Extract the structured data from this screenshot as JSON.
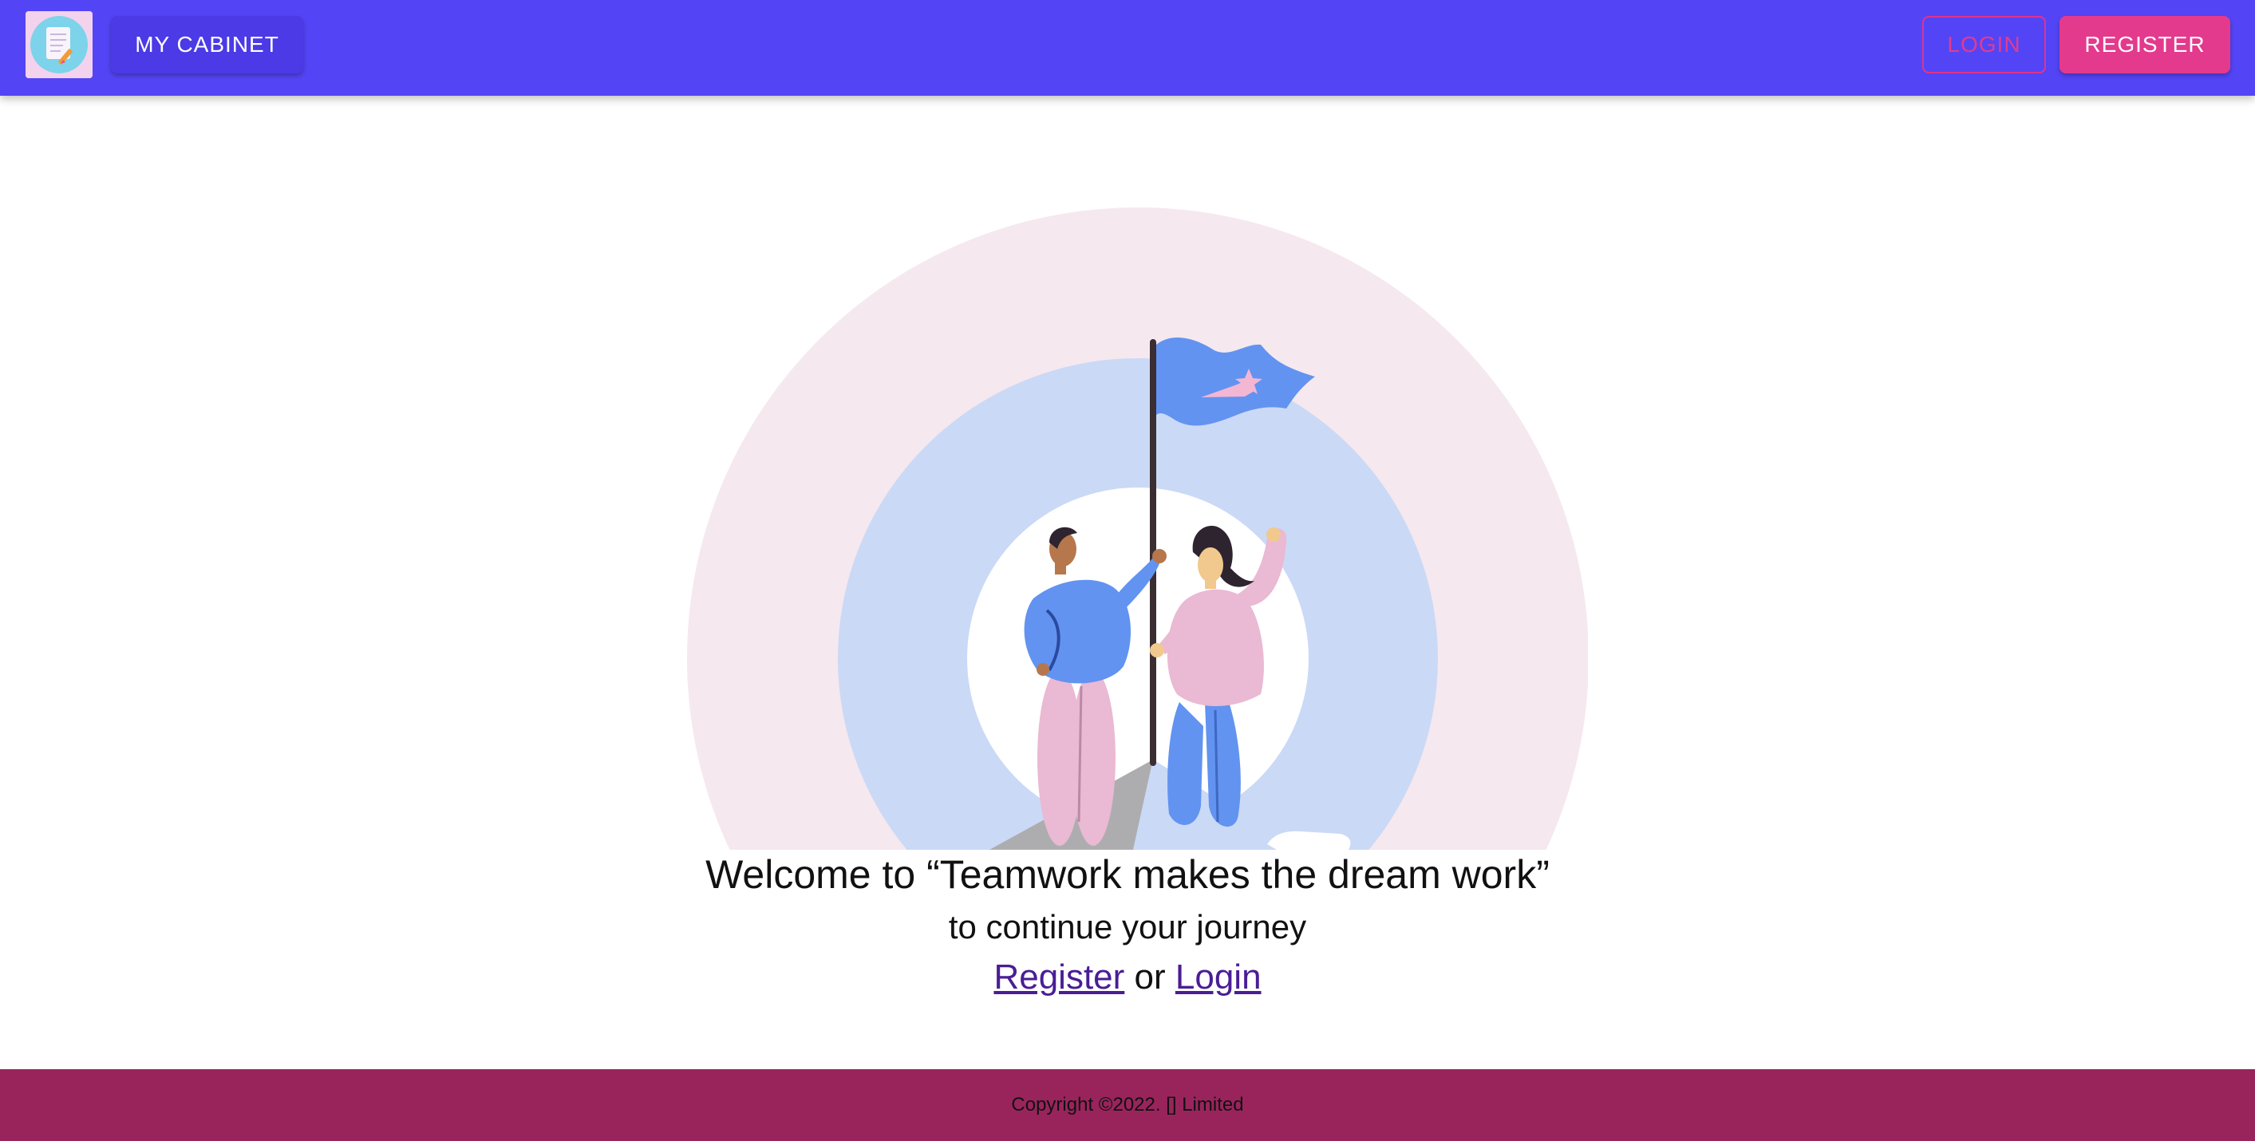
{
  "header": {
    "logo_icon": "notepad-pencil-icon",
    "cabinet_label": "MY CABINET",
    "login_label": "LOGIN",
    "register_label": "REGISTER"
  },
  "hero": {
    "illustration": "two-people-with-flag-on-mountain"
  },
  "main": {
    "welcome": "Welcome to “Teamwork makes the dream work”",
    "subtitle": "to continue your journey",
    "register_link": "Register",
    "or_text": " or ",
    "login_link": "Login"
  },
  "footer": {
    "copyright": "Copyright ©2022. [] Limited"
  },
  "colors": {
    "appbar": "#5345f5",
    "accent_pink": "#e33a8d",
    "footer": "#99245c",
    "link": "#4a1d96"
  }
}
